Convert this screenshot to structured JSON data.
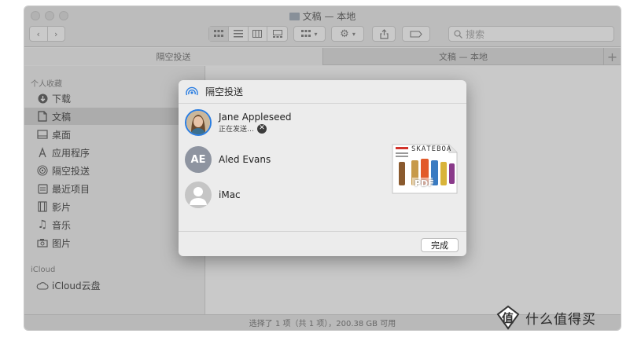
{
  "window": {
    "title": "文稿 — 本地"
  },
  "toolbar": {
    "search_placeholder": "搜索"
  },
  "tabs": [
    {
      "label": "隔空投送"
    },
    {
      "label": "文稿 — 本地"
    }
  ],
  "sidebar": {
    "favorites_title": "个人收藏",
    "favorites": [
      {
        "label": "下载"
      },
      {
        "label": "文稿"
      },
      {
        "label": "桌面"
      },
      {
        "label": "应用程序"
      },
      {
        "label": "隔空投送"
      },
      {
        "label": "最近项目"
      },
      {
        "label": "影片"
      },
      {
        "label": "音乐"
      },
      {
        "label": "图片"
      }
    ],
    "icloud_title": "iCloud",
    "icloud": [
      {
        "label": "iCloud云盘"
      }
    ]
  },
  "status": {
    "text": "选择了 1 项（共 1 项），200.38 GB 可用"
  },
  "sheet": {
    "title": "隔空投送",
    "people": [
      {
        "name": "Jane Appleseed",
        "status": "正在发送…",
        "avatar": "photo"
      },
      {
        "name": "Aled Evans",
        "initials": "AE",
        "avatar": "initials"
      },
      {
        "name": "iMac",
        "avatar": "generic"
      }
    ],
    "document": {
      "header": "SKATEBOA",
      "badge": "PDF"
    },
    "done_label": "完成"
  },
  "watermark": {
    "text": "什么值得买",
    "logo": "值"
  }
}
